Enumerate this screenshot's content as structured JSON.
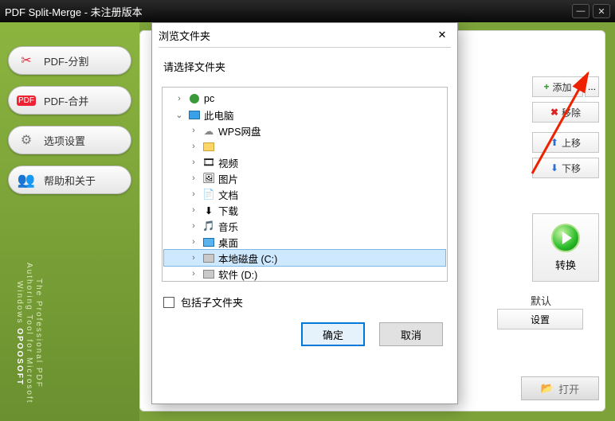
{
  "titlebar": {
    "title": "PDF Split-Merge - 未注册版本"
  },
  "sidebar": {
    "items": [
      {
        "label": "PDF-分割"
      },
      {
        "label": "PDF-合并"
      },
      {
        "label": "选项设置"
      },
      {
        "label": "帮助和关于"
      }
    ],
    "brand": "OPOOSOFT",
    "tagline": "The Professional PDF Authoring Tool for Microsoft Windows"
  },
  "rightpanel": {
    "add": "添加",
    "addmore": "...",
    "remove": "移除",
    "up": "上移",
    "down": "下移",
    "convert": "转换",
    "default": "默认",
    "settings": "设置",
    "open": "打开"
  },
  "dialog": {
    "title": "浏览文件夹",
    "prompt": "请选择文件夹",
    "include_sub": "包括子文件夹",
    "ok": "确定",
    "cancel": "取消",
    "tree": [
      {
        "exp": ">",
        "ind": 1,
        "icon": "user",
        "label": "pc"
      },
      {
        "exp": "v",
        "ind": 1,
        "icon": "monitor",
        "label": "此电脑"
      },
      {
        "exp": ">",
        "ind": 2,
        "icon": "cloud",
        "label": "WPS网盘"
      },
      {
        "exp": ">",
        "ind": 2,
        "icon": "folder",
        "label": ""
      },
      {
        "exp": ">",
        "ind": 2,
        "icon": "video",
        "label": "视频"
      },
      {
        "exp": ">",
        "ind": 2,
        "icon": "image",
        "label": "图片"
      },
      {
        "exp": ">",
        "ind": 2,
        "icon": "doc",
        "label": "文档"
      },
      {
        "exp": ">",
        "ind": 2,
        "icon": "download",
        "label": "下载"
      },
      {
        "exp": ">",
        "ind": 2,
        "icon": "music",
        "label": "音乐"
      },
      {
        "exp": ">",
        "ind": 2,
        "icon": "desktop",
        "label": "桌面"
      },
      {
        "exp": ">",
        "ind": 2,
        "icon": "disk",
        "label": "本地磁盘 (C:)",
        "selected": true
      },
      {
        "exp": ">",
        "ind": 2,
        "icon": "disk",
        "label": "软件 (D:)"
      }
    ]
  }
}
